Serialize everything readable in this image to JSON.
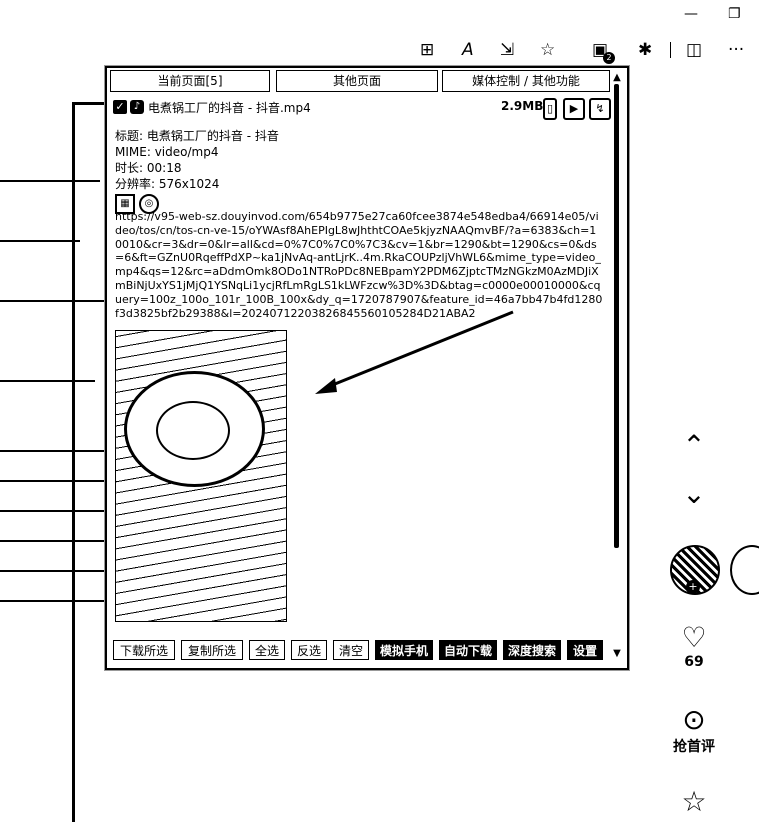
{
  "window_controls": {
    "minimize": "—",
    "restore": "❐"
  },
  "browser_toolbar": {
    "grid_icon": "⊞",
    "read_aloud_icon": "A",
    "share_icon": "⇲",
    "favorite_icon": "☆",
    "extension_icon": "▣",
    "extension_badge": "2",
    "puzzle_icon": "✱",
    "split_icon": "◫",
    "more_icon": "···"
  },
  "popup": {
    "tabs": [
      "当前页面[5]",
      "其他页面",
      "媒体控制 / 其他功能"
    ],
    "file": {
      "checkbox": "✓",
      "site_icon": "♪",
      "name": "电煮锅工厂的抖音 - 抖音.mp4",
      "size": "2.9MB",
      "icons": {
        "copy": "▯",
        "play": "▶",
        "download": "↯"
      }
    },
    "info": {
      "title_label": "标题:",
      "title_value": "电煮锅工厂的抖音 - 抖音",
      "mime_label": "MIME:",
      "mime_value": "video/mp4",
      "duration_label": "时长:",
      "duration_value": "00:18",
      "resolution_label": "分辨率:",
      "resolution_value": "576x1024",
      "qr_icon": "▦",
      "preview_icon": "◎"
    },
    "url": "https://v95-web-sz.douyinvod.com/654b9775e27ca60fcee3874e548edba4/66914e05/video/tos/cn/tos-cn-ve-15/oYWAsf8AhEPIgL8wJhthtCOAe5kjyzNAAQmvBF/?a=6383&ch=10010&cr=3&dr=0&lr=all&cd=0%7C0%7C0%7C3&cv=1&br=1290&bt=1290&cs=0&ds=6&ft=GZnU0RqeffPdXP~ka1jNvAq-antLjrK..4m.RkaCOUPzljVhWL6&mime_type=video_mp4&qs=12&rc=aDdmOmk8ODo1NTRoPDc8NEBpamY2PDM6ZjptcTMzNGkzM0AzMDJiXmBiNjUxYS1jMjQ1YSNqLi1ycjRfLmRgLS1kLWFzcw%3D%3D&btag=c0000e00010000&cquery=100z_100o_101r_100B_100x&dy_q=1720787907&feature_id=46a7bb47b4fd1280f3d3825bf2b29388&l=20240712203826845560105284D21ABA2",
    "actions": [
      "下载所选",
      "复制所选",
      "全选",
      "反选",
      "清空",
      "模拟手机",
      "自动下载",
      "深度搜索",
      "设置"
    ],
    "scroll": {
      "up": "▲",
      "down": "▼"
    }
  },
  "sidebar": {
    "up_icon": "⌃",
    "down_icon": "⌄",
    "avatar_plus": "+",
    "like_icon": "♡",
    "like_count": "69",
    "comment_icon": "⊙",
    "comment_label": "抢首评",
    "favorite_icon": "☆"
  }
}
